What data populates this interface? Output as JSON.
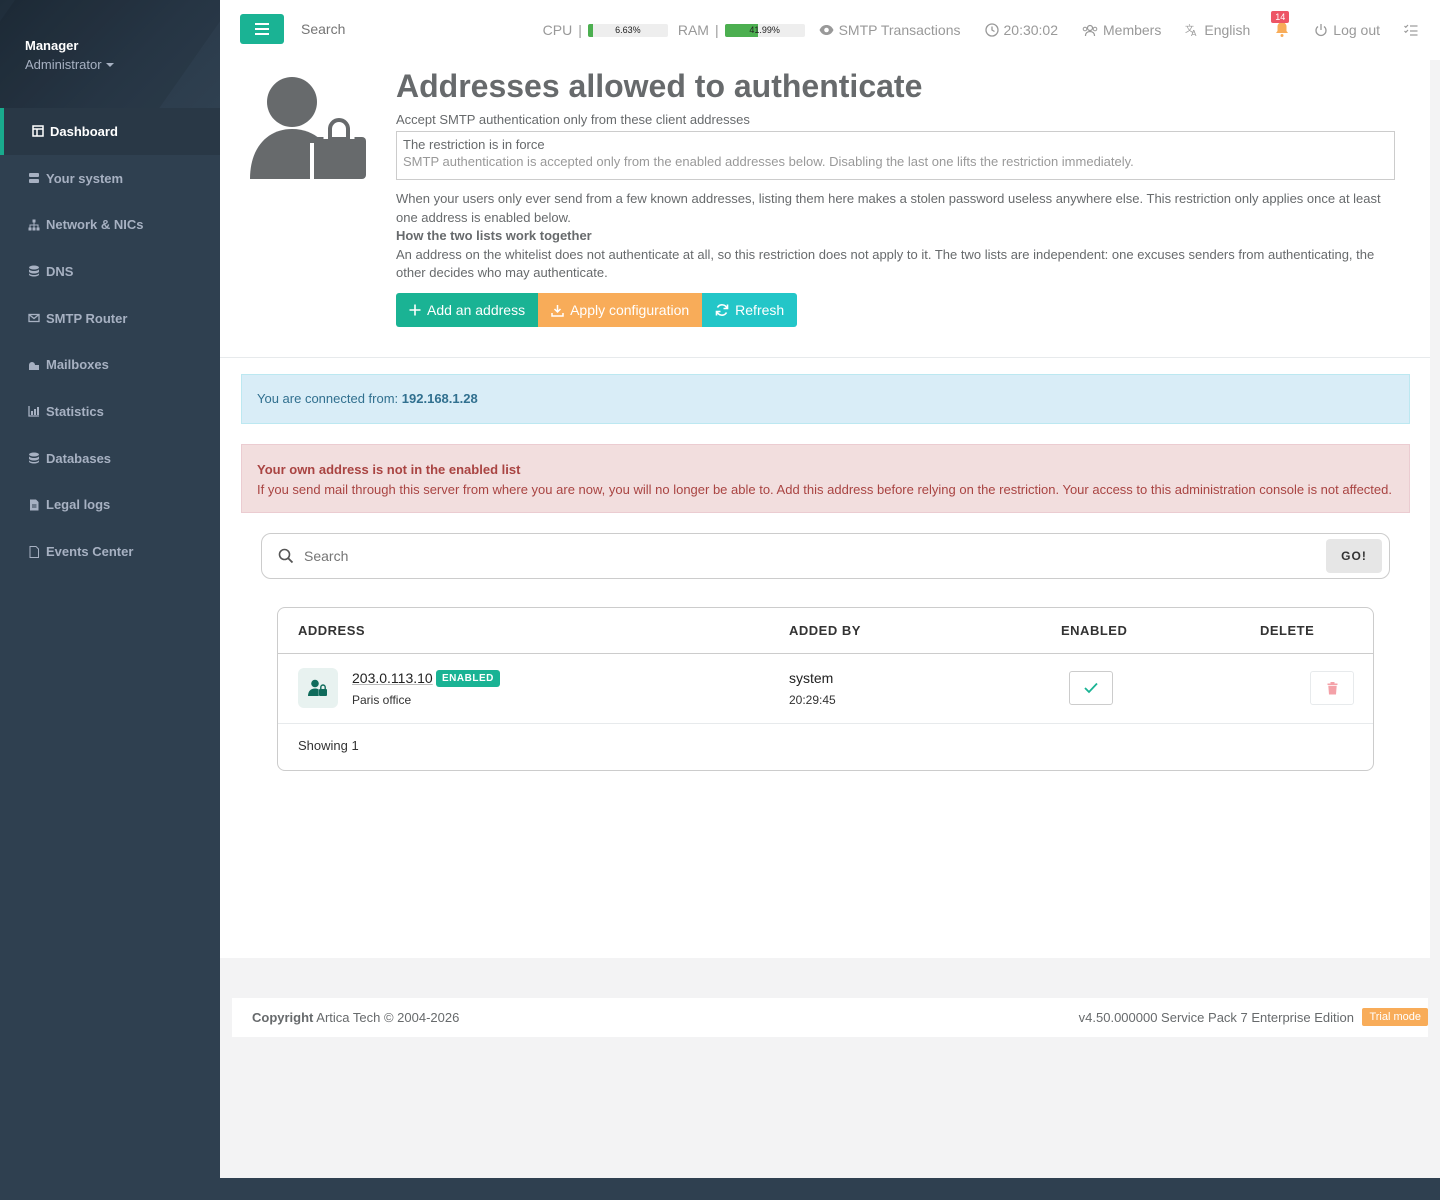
{
  "sidebar": {
    "user_name": "Manager",
    "user_role": "Administrator",
    "items": [
      {
        "label": "Dashboard",
        "icon": "dashboard-icon"
      },
      {
        "label": "Your system",
        "icon": "server-icon"
      },
      {
        "label": "Network & NICs",
        "icon": "network-icon"
      },
      {
        "label": "DNS",
        "icon": "database-icon"
      },
      {
        "label": "SMTP Router",
        "icon": "envelope-icon"
      },
      {
        "label": "Mailboxes",
        "icon": "mailbox-icon"
      },
      {
        "label": "Statistics",
        "icon": "chart-icon"
      },
      {
        "label": "Databases",
        "icon": "database-icon"
      },
      {
        "label": "Legal logs",
        "icon": "file-icon"
      },
      {
        "label": "Events Center",
        "icon": "file-icon"
      }
    ]
  },
  "topbar": {
    "search_placeholder": "Search",
    "cpu_label": "CPU",
    "cpu_value": "6.63%",
    "cpu_fraction": 0.0663,
    "ram_label": "RAM",
    "ram_value": "41.99%",
    "ram_fraction": 0.4199,
    "smtp_transactions": "SMTP Transactions",
    "clock": "20:30:02",
    "members": "Members",
    "language": "English",
    "notifications_count": "14",
    "logout": "Log out"
  },
  "header": {
    "title": "Addresses allowed to authenticate",
    "subtitle": "Accept SMTP authentication only from these client addresses",
    "restriction_title": "The restriction is in force",
    "restriction_text": "SMTP authentication is accepted only from the enabled addresses below. Disabling the last one lifts the restriction immediately.",
    "description": "When your users only ever send from a few known addresses, listing them here makes a stolen password useless anywhere else. This restriction only applies once at least one address is enabled below.",
    "lists_heading": "How the two lists work together",
    "lists_text": "An address on the whitelist does not authenticate at all, so this restriction does not apply to it. The two lists are independent: one excuses senders from authenticating, the other decides who may authenticate.",
    "btn_add": "Add an address",
    "btn_apply": "Apply configuration",
    "btn_refresh": "Refresh"
  },
  "info_alert": {
    "prefix": "You are connected from:",
    "ip": "192.168.1.28"
  },
  "danger_alert": {
    "title": "Your own address is not in the enabled list",
    "text": "If you send mail through this server from where you are now, you will no longer be able to. Add this address before relying on the restriction. Your access to this administration console is not affected."
  },
  "search": {
    "placeholder": "Search",
    "go_label": "GO!"
  },
  "table": {
    "headers": {
      "address": "ADDRESS",
      "added_by": "ADDED BY",
      "enabled": "ENABLED",
      "delete": "DELETE"
    },
    "rows": [
      {
        "address": "203.0.113.10",
        "badge": "ENABLED",
        "note": "Paris office",
        "added_by": "system",
        "added_time": "20:29:45",
        "enabled": true
      }
    ],
    "showing": "Showing 1"
  },
  "footer": {
    "copyright_label": "Copyright",
    "copyright_text": "Artica Tech © 2004-2026",
    "version": "v4.50.000000 Service Pack 7 Enterprise Edition",
    "trial": "Trial mode"
  },
  "colors": {
    "accent": "#1ab394",
    "sidebar_bg": "#2f4050",
    "warning": "#f8ac59",
    "info": "#23c6c8",
    "danger": "#ed5565"
  }
}
